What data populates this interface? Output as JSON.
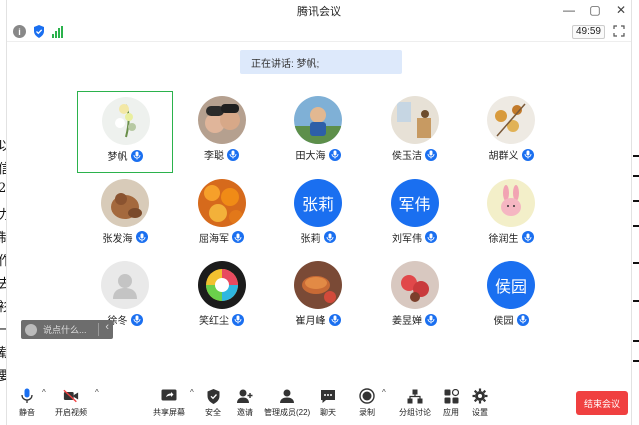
{
  "window": {
    "title": "腾讯会议"
  },
  "infobar": {
    "timer": "49:59"
  },
  "speaking": {
    "label": "正在讲话: 梦帆;"
  },
  "participants": [
    {
      "name": "梦帆",
      "avatar": "photo-flower",
      "active": true
    },
    {
      "name": "李聪",
      "avatar": "photo-couple",
      "active": false
    },
    {
      "name": "田大海",
      "avatar": "photo-boy",
      "active": false
    },
    {
      "name": "侯玉洁",
      "avatar": "photo-room",
      "active": false
    },
    {
      "name": "胡群义",
      "avatar": "photo-leaves",
      "active": false
    },
    {
      "name": "张发海",
      "avatar": "photo-dog",
      "active": false
    },
    {
      "name": "屈海军",
      "avatar": "photo-orange-flowers",
      "active": false
    },
    {
      "name": "张莉",
      "avatar": "text",
      "avatar_text": "张莉",
      "active": false
    },
    {
      "name": "刘军伟",
      "avatar": "text",
      "avatar_text": "军伟",
      "active": false
    },
    {
      "name": "徐润生",
      "avatar": "photo-bunny",
      "active": false
    },
    {
      "name": "徐冬",
      "avatar": "default-person",
      "active": false
    },
    {
      "name": "笑红尘",
      "avatar": "photo-colorful-logo",
      "active": false
    },
    {
      "name": "崔月峰",
      "avatar": "photo-tea",
      "active": false
    },
    {
      "name": "姜昱婵",
      "avatar": "photo-fruit",
      "active": false
    },
    {
      "name": "侯园",
      "avatar": "text",
      "avatar_text": "侯园",
      "active": false
    }
  ],
  "chat": {
    "placeholder": "说点什么..."
  },
  "toolbar": {
    "mute": "静音",
    "video": "开启视频",
    "share": "共享屏幕",
    "security": "安全",
    "invite": "邀请",
    "members": "管理成员(22)",
    "chat": "聊天",
    "record": "录制",
    "breakout": "分组讨论",
    "apps": "应用",
    "settings": "设置",
    "end": "结束会议"
  },
  "colors": {
    "accent": "#1a6ff0",
    "end": "#f04040",
    "active_border": "#2bb24c"
  }
}
